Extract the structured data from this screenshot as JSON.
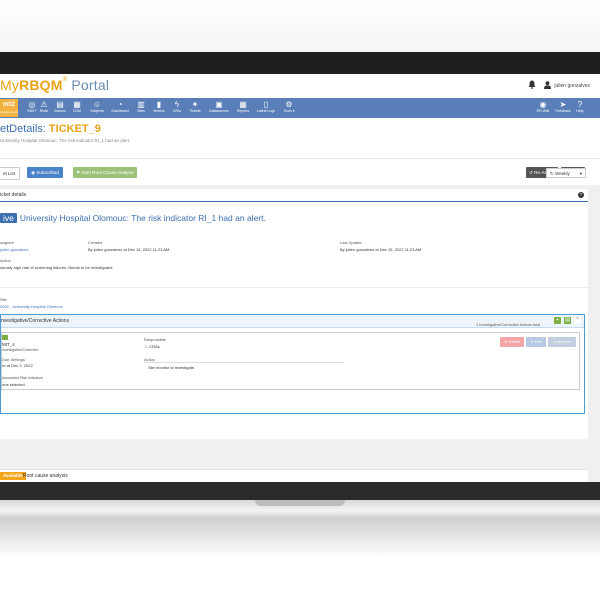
{
  "brand": {
    "my": "My",
    "rbqm": "RBQM",
    "portal": "Portal"
  },
  "user": {
    "name": "julien gonzalvez"
  },
  "nav_brand": {
    "label": "m02",
    "sub": "change study"
  },
  "nav": [
    {
      "label": "RAVT",
      "icon": "target-icon"
    },
    {
      "label": "Risks",
      "icon": "warning-icon"
    },
    {
      "label": "Actions",
      "icon": "clipboard-icon"
    },
    {
      "label": "CDM",
      "icon": "calendar-icon"
    },
    {
      "label": "Subjects",
      "icon": "users-icon"
    },
    {
      "label": "Dashboard",
      "icon": "gauge-icon"
    },
    {
      "label": "Sites",
      "icon": "building-icon"
    },
    {
      "label": "Metrics",
      "icon": "bar-chart-icon"
    },
    {
      "label": "KRIs",
      "icon": "bolt-icon"
    },
    {
      "label": "Tickets",
      "icon": "ticket-icon"
    },
    {
      "label": "Datasources",
      "icon": "disk-icon"
    },
    {
      "label": "Reports",
      "icon": "grid-icon"
    },
    {
      "label": "Latest Logs",
      "icon": "document-icon"
    },
    {
      "label": "Tools ▾",
      "icon": "cogs-icon"
    }
  ],
  "nav_right": [
    {
      "label": "RR Wiki",
      "icon": "compass-icon"
    },
    {
      "label": "Feedback",
      "icon": "send-icon"
    },
    {
      "label": "Help",
      "icon": "help-icon"
    }
  ],
  "page": {
    "title_prefix": "etDetails: ",
    "ticket": "TICKET_9",
    "subtitle": "University Hospital Olomouc: The risk indicator RI_1 had an alert."
  },
  "actions": {
    "list": "et List",
    "subscribed": "Subscribed",
    "start_rca": "Start Root Cause Analysis",
    "reassign": "Re-Assign",
    "close": "Close",
    "weekly": "Weekly"
  },
  "details": {
    "panel_title": "icket details",
    "status": "ive",
    "alert_title": "University Hospital Olomouc: The risk indicator RI_1 had an alert.",
    "assignee_label": "ssignee",
    "assignee_value": "julien gonzalvez",
    "created_label": "Created",
    "created_value": "By julien gonzalvez at Dec 15, 2022 11:23 AM",
    "updated_label": "Last Update",
    "updated_value": "By julien gonzalvez at Dec 15, 2022 11:23 AM",
    "description_label": "ription",
    "description_value": "usually high rate of screening failures. Needs to be investigated.",
    "site_label": "Site",
    "site_value": "0002 - University Hospital Olomouc"
  },
  "investigative": {
    "title": "nvestigative/Corrective Actions",
    "total": "1 Investigative/Corrective Actions total",
    "action_id": "MIT_4",
    "action_type": "Investigative/Corrective",
    "due_label": "Due Settings",
    "due_value": "re at Dec 2, 2022",
    "indicators_label": "Associated Risk Indicators",
    "indicators_value": "one selected",
    "responsible_label": "Responsible",
    "responsible_value": "CRAs",
    "action_label": "Action",
    "action_value": "Site monitor to investigate.",
    "delete": "Delete",
    "edit": "Edit",
    "archive": "Archive"
  },
  "rca": {
    "badge": "Available",
    "label": "Root cause analysis"
  }
}
